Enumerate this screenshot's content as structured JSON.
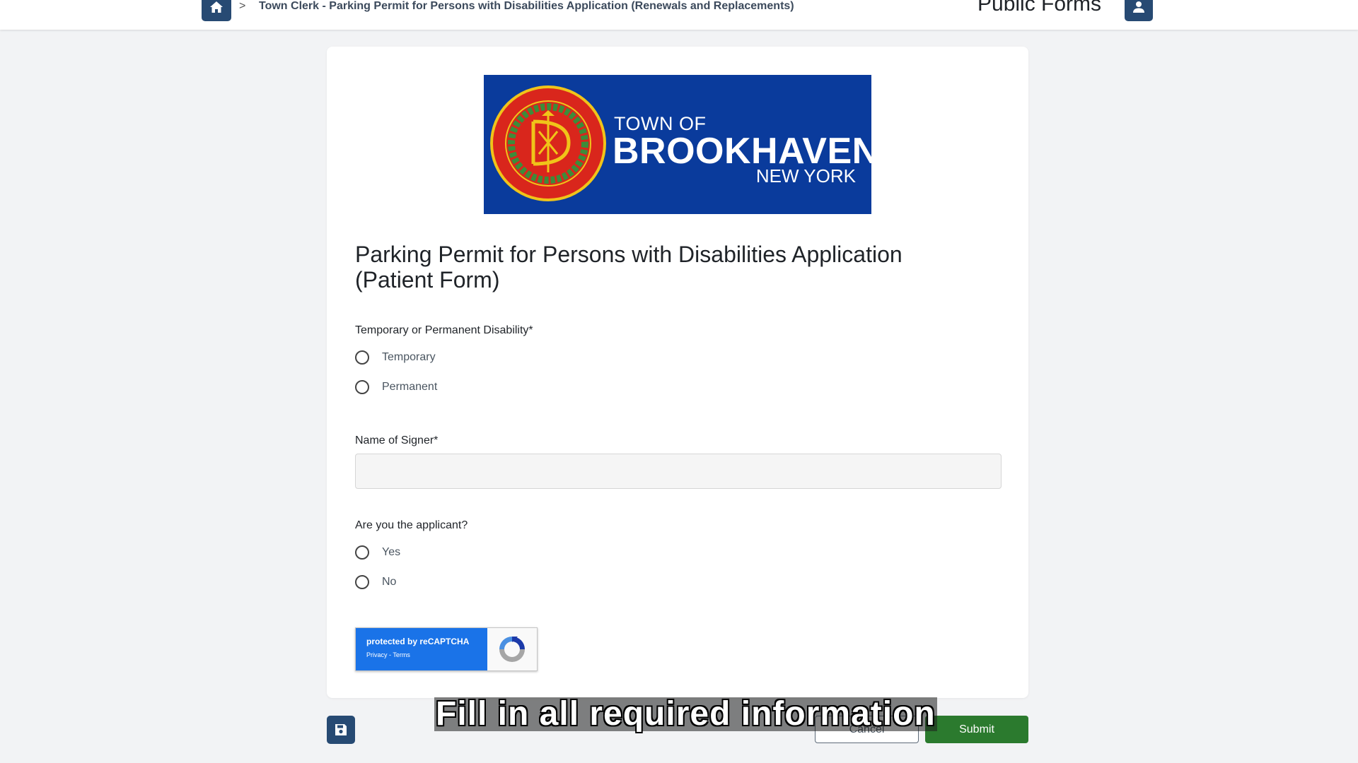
{
  "header": {
    "home_icon": "home-icon",
    "breadcrumb_separator": ">",
    "breadcrumb_text": "Town Clerk - Parking Permit for Persons with Disabilities Application (Renewals and Replacements)",
    "brand_title": "Public Forms",
    "user_icon": "user-icon",
    "accent_color": "#274a73"
  },
  "banner": {
    "town_of": "TOWN OF",
    "name": "BROOKHAVEN",
    "state": "NEW YORK",
    "seal_text_top": "TOWN OF BROOKHAVEN NEW YORK",
    "seal_year": "1655",
    "background_color": "#0a3b9c"
  },
  "form": {
    "title": "Parking Permit for Persons with Disabilities Application (Patient Form)",
    "disability_question": {
      "label": "Temporary or Permanent Disability*",
      "options": [
        "Temporary",
        "Permanent"
      ]
    },
    "signer": {
      "label": "Name of Signer*",
      "value": "",
      "placeholder": ""
    },
    "applicant_question": {
      "label": "Are you the applicant?",
      "options": [
        "Yes",
        "No"
      ]
    },
    "recaptcha": {
      "protected_text": "protected by reCAPTCHA",
      "links_text": "Privacy - Terms"
    }
  },
  "footer": {
    "save_icon": "save-icon",
    "cancel_label": "Cancel",
    "submit_label": "Submit",
    "submit_color": "#2b7a2e"
  },
  "caption": "Fill in all required information"
}
